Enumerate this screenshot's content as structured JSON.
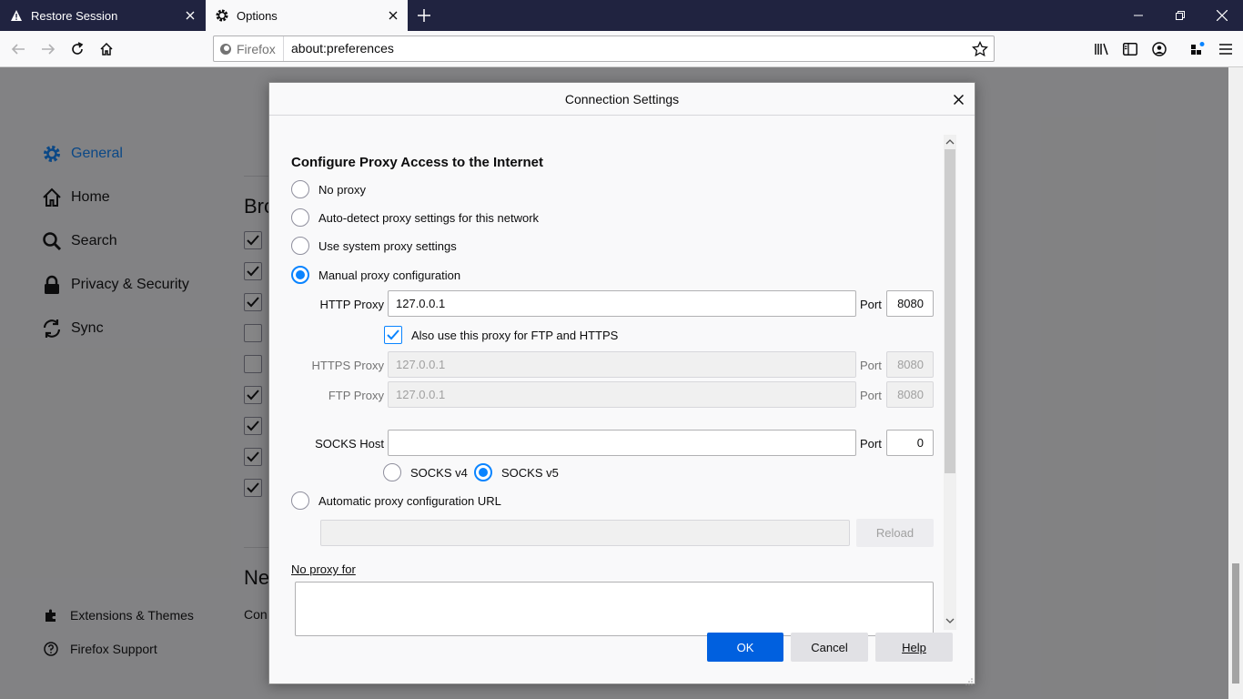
{
  "tabs": [
    {
      "title": "Restore Session",
      "icon": "warning-icon"
    },
    {
      "title": "Options",
      "icon": "gear-icon"
    }
  ],
  "url_bar": {
    "identity": "Firefox",
    "url": "about:preferences"
  },
  "sidebar": {
    "items": [
      {
        "label": "General",
        "icon": "gear-icon",
        "active": true
      },
      {
        "label": "Home",
        "icon": "home-icon"
      },
      {
        "label": "Search",
        "icon": "search-icon"
      },
      {
        "label": "Privacy & Security",
        "icon": "lock-icon"
      },
      {
        "label": "Sync",
        "icon": "sync-icon"
      }
    ],
    "footer": [
      {
        "label": "Extensions & Themes",
        "icon": "puzzle-icon"
      },
      {
        "label": "Firefox Support",
        "icon": "help-icon"
      }
    ]
  },
  "background": {
    "section1": "Bro",
    "section2": "Net",
    "section2_text": "Con"
  },
  "dialog": {
    "title": "Connection Settings",
    "heading": "Configure Proxy Access to the Internet",
    "options": {
      "no_proxy": "No proxy",
      "auto_detect": "Auto-detect proxy settings for this network",
      "system": "Use system proxy settings",
      "manual": "Manual proxy configuration",
      "auto_url": "Automatic proxy configuration URL"
    },
    "http_proxy": {
      "label": "HTTP Proxy",
      "value": "127.0.0.1",
      "port_label": "Port",
      "port": "8080"
    },
    "also_use": "Also use this proxy for FTP and HTTPS",
    "https_proxy": {
      "label": "HTTPS Proxy",
      "value": "127.0.0.1",
      "port_label": "Port",
      "port": "8080"
    },
    "ftp_proxy": {
      "label": "FTP Proxy",
      "value": "127.0.0.1",
      "port_label": "Port",
      "port": "8080"
    },
    "socks": {
      "label": "SOCKS Host",
      "value": "",
      "port_label": "Port",
      "port": "0",
      "v4": "SOCKS v4",
      "v5": "SOCKS v5"
    },
    "auto_url_value": "",
    "reload": "Reload",
    "no_proxy_for": "No proxy for",
    "buttons": {
      "ok": "OK",
      "cancel": "Cancel",
      "help": "Help"
    }
  },
  "colors": {
    "accent": "#0a84ff",
    "ok_button": "#0060df",
    "titlebar": "#202340"
  }
}
